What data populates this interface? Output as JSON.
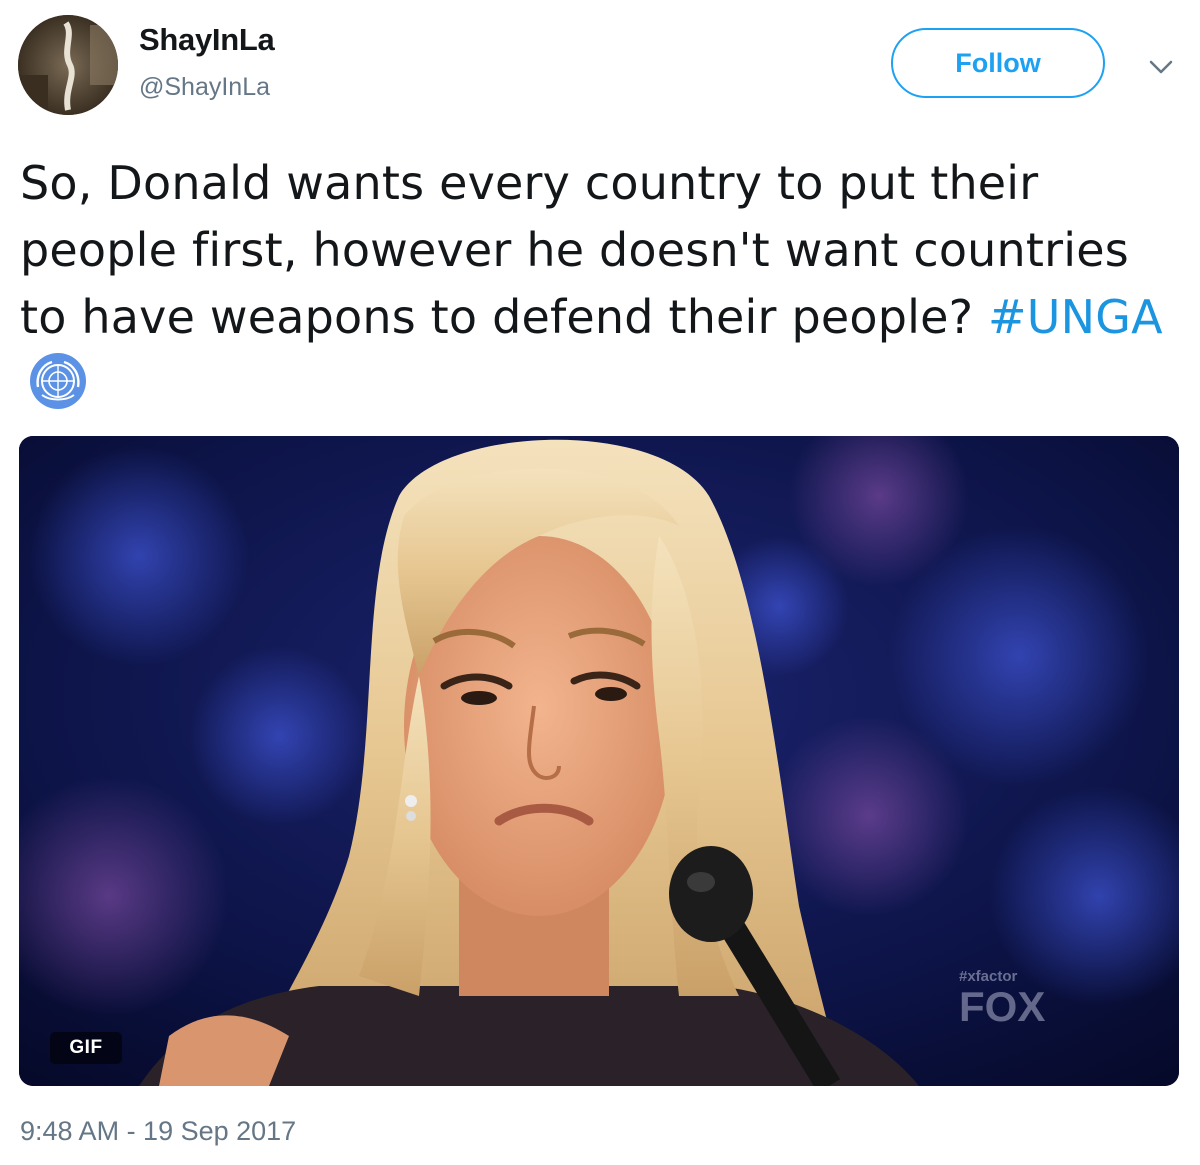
{
  "user": {
    "display_name": "ShayInLa",
    "handle": "@ShayInLa"
  },
  "follow_button": {
    "label": "Follow"
  },
  "tweet": {
    "text_before_hashtag": "So, Donald wants every country to put their people first, however he doesn't want countries to have weapons to defend their people? ",
    "hashtag": "#UNGA",
    "emoji": "united-nations-flag-icon"
  },
  "media": {
    "type_badge": "GIF",
    "watermark_small": "#xfactor",
    "watermark_large": "FOX"
  },
  "footer": {
    "timestamp": "9:48 AM - 19 Sep 2017"
  },
  "colors": {
    "accent": "#1da1f2",
    "hashtag": "#1b95e0",
    "secondary_text": "#657786",
    "primary_text": "#14171a"
  }
}
